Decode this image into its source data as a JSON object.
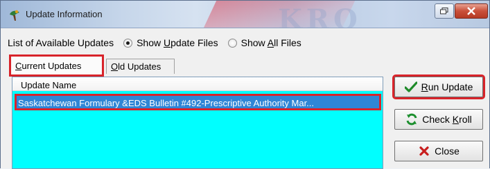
{
  "window": {
    "title": "Update Information",
    "icon": "app-icon",
    "watermark": "KRO"
  },
  "options": {
    "label": "List of Available Updates",
    "radios": [
      {
        "pre": "Show ",
        "accel": "U",
        "post": "pdate Files",
        "selected": true
      },
      {
        "pre": "Show ",
        "accel": "A",
        "post": "ll Files",
        "selected": false
      }
    ]
  },
  "tabs": [
    {
      "accel": "C",
      "rest": "urrent Updates",
      "active": true
    },
    {
      "accel": "O",
      "rest": "ld Updates",
      "active": false
    }
  ],
  "list": {
    "header": "Update Name",
    "rows": [
      "Saskatchewan Formulary &EDS Bulletin #492-Prescriptive Authority Mar..."
    ],
    "background": "#00ffff",
    "selection_color": "#2f86d6"
  },
  "buttons": {
    "run": {
      "accel": "R",
      "rest": "un Update",
      "icon": "checkmark-icon"
    },
    "check": {
      "pre": "Check ",
      "accel": "K",
      "rest": "roll",
      "icon": "refresh-icon"
    },
    "close": {
      "label": "Close",
      "icon": "x-icon"
    }
  },
  "highlight_color": "#d8232a"
}
